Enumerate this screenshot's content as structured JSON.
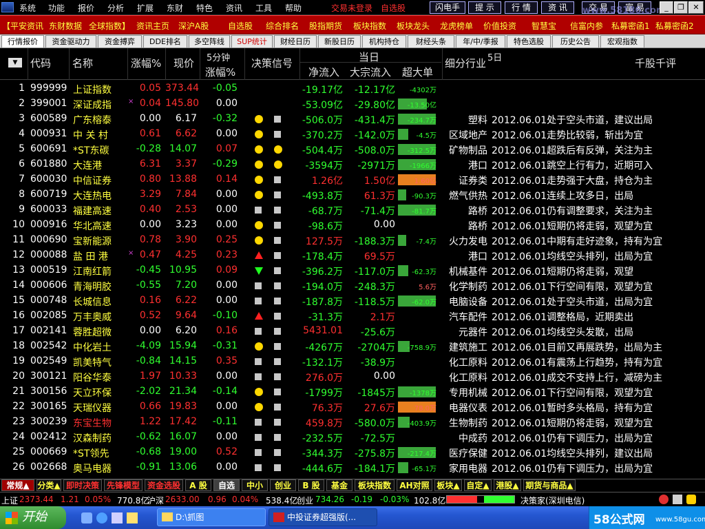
{
  "menu": {
    "items": [
      "系统",
      "功能",
      "报价",
      "分析",
      "扩展",
      "东财",
      "特色",
      "资讯",
      "工具",
      "帮助"
    ],
    "trade_status": "交易未登录",
    "self_select": "自选股",
    "buttons": [
      "闪电手",
      "提 示",
      "行 情",
      "资 讯",
      "交 易",
      "富 易"
    ],
    "watermark": "www.58186.com"
  },
  "linkbar": [
    "【平安资讯",
    "东财数据",
    "全球指数】",
    "资讯主页",
    "深沪A股",
    "自选股",
    "综合排名",
    "股指期货",
    "板块指数",
    "板块龙头",
    "龙虎榜单",
    "价值投资",
    "智慧宝",
    "信富内参",
    "私募密函1",
    "私募密函2"
  ],
  "tabs": [
    "行情报价",
    "资金驱动力",
    "资金搏弈",
    "DDE排名",
    "多空阵线",
    "SUP统计",
    "财经日历",
    "新股日历",
    "机构持仓",
    "财经头条",
    "年/中/季报",
    "特色选股",
    "历史公告",
    "宏观指数"
  ],
  "header": {
    "code": "代码",
    "name": "名称",
    "change_pct": "涨幅%",
    "price": "现价",
    "five_min_top": "5分钟",
    "five_min_bottom": "涨幅%",
    "signal": "决策信号",
    "today": "当日",
    "net_inflow": "净流入",
    "block_inflow": "大宗流入",
    "super_order": "超大单",
    "industry": "细分行业",
    "five_day": "5日",
    "comment": "千股千评"
  },
  "rows": [
    {
      "no": "1",
      "code": "999999",
      "name": "上证指数",
      "mark": "",
      "chg": "0.05",
      "price": "373.44",
      "m5": "-0.05",
      "sig1": "",
      "sig2": "",
      "net": "-19.17亿",
      "blk": "-12.17亿",
      "bar": "-4302万",
      "barv": 0,
      "ind": "",
      "cmt": ""
    },
    {
      "no": "2",
      "code": "399001",
      "name": "深证成指",
      "mark": "×",
      "chg": "0.04",
      "price": "145.80",
      "m5": "0.00",
      "sig1": "",
      "sig2": "",
      "net": "-53.09亿",
      "blk": "-29.80亿",
      "bar": "-13.50亿",
      "barv": 0.72,
      "ind": "",
      "cmt": ""
    },
    {
      "no": "3",
      "code": "600589",
      "name": "广东榕泰",
      "mark": "",
      "chg": "0.00",
      "price": "6.17",
      "m5": "-0.32",
      "sig1": "dot",
      "sig2": "sq",
      "net": "-506.0万",
      "blk": "-431.4万",
      "bar": "-234.7万",
      "barv": 0.95,
      "ind": "塑料",
      "cmt": "2012.06.01处于空头市道，建议出局"
    },
    {
      "no": "4",
      "code": "000931",
      "name": "中 关 村",
      "mark": "",
      "chg": "0.61",
      "price": "6.62",
      "m5": "0.00",
      "sig1": "dot",
      "sig2": "sq",
      "net": "-370.2万",
      "blk": "-142.0万",
      "bar": "-4.5万",
      "barv": 0.25,
      "ind": "区域地产",
      "cmt": "2012.06.01走势比较弱，斩出为宜"
    },
    {
      "no": "5",
      "code": "600691",
      "name": "*ST东碳",
      "mark": "",
      "chg": "-0.28",
      "price": "14.07",
      "m5": "0.07",
      "sig1": "dot",
      "sig2": "dot",
      "net": "-504.4万",
      "blk": "-508.0万",
      "bar": "-312.5万",
      "barv": 0.95,
      "ind": "矿物制品",
      "cmt": "2012.06.01超跌后有反弹，关注为主"
    },
    {
      "no": "6",
      "code": "601880",
      "name": "大连港",
      "mark": "",
      "chg": "6.31",
      "price": "3.37",
      "m5": "-0.29",
      "sig1": "dot",
      "sig2": "dot",
      "net": "-3594万",
      "blk": "-2971万",
      "bar": "-1966万",
      "barv": 0.95,
      "ind": "港口",
      "cmt": "2012.06.01跳空上行有力，近期可入"
    },
    {
      "no": "7",
      "code": "600030",
      "name": "中信证券",
      "mark": "",
      "chg": "0.80",
      "price": "13.88",
      "m5": "0.14",
      "sig1": "dot",
      "sig2": "sq",
      "net": "1.26亿",
      "blk": "1.50亿",
      "bar": "1.60亿",
      "barv": 0.95,
      "ind": "证券类",
      "cmt": "2012.06.01走势强于大盘，持仓为主"
    },
    {
      "no": "8",
      "code": "600719",
      "name": "大连热电",
      "mark": "",
      "chg": "3.29",
      "price": "7.84",
      "m5": "0.00",
      "sig1": "dot",
      "sig2": "sq",
      "net": "-493.8万",
      "blk": "61.3万",
      "bar": "-90.3万",
      "barv": 0.2,
      "ind": "燃气供热",
      "cmt": "2012.06.01连续上攻多日，出局"
    },
    {
      "no": "9",
      "code": "600033",
      "name": "福建高速",
      "mark": "",
      "chg": "0.40",
      "price": "2.53",
      "m5": "0.00",
      "sig1": "sq",
      "sig2": "sq",
      "net": "-68.7万",
      "blk": "-71.4万",
      "bar": "-81.7万",
      "barv": 0.95,
      "ind": "路桥",
      "cmt": "2012.06.01仍有调整要求，关注为主"
    },
    {
      "no": "10",
      "code": "000916",
      "name": "华北高速",
      "mark": "",
      "chg": "0.00",
      "price": "3.23",
      "m5": "0.00",
      "sig1": "dot",
      "sig2": "sq",
      "net": "-98.6万",
      "blk": "0.00",
      "bar": "",
      "barv": 0,
      "ind": "路桥",
      "cmt": "2012.06.01短期仍将走弱，观望为宜"
    },
    {
      "no": "11",
      "code": "000690",
      "name": "宝新能源",
      "mark": "",
      "chg": "0.78",
      "price": "3.90",
      "m5": "0.25",
      "sig1": "dot",
      "sig2": "sq",
      "net": "127.5万",
      "blk": "-188.3万",
      "bar": "-7.4万",
      "barv": 0.2,
      "ind": "火力发电",
      "cmt": "2012.06.01中期有走好迹象，持有为宜"
    },
    {
      "no": "12",
      "code": "000088",
      "name": "盐 田 港",
      "mark": "×",
      "chg": "0.47",
      "price": "4.25",
      "m5": "0.23",
      "sig1": "up",
      "sig2": "sq",
      "net": "-178.4万",
      "blk": "69.5万",
      "bar": "",
      "barv": 0,
      "ind": "港口",
      "cmt": "2012.06.01均线空头排列，出局为宜"
    },
    {
      "no": "13",
      "code": "000519",
      "name": "江南红箭",
      "mark": "",
      "chg": "-0.45",
      "price": "10.95",
      "m5": "0.09",
      "sig1": "down",
      "sig2": "sq",
      "net": "-396.2万",
      "blk": "-117.0万",
      "bar": "-62.3万",
      "barv": 0.25,
      "ind": "机械基件",
      "cmt": "2012.06.01短期仍将走弱，观望"
    },
    {
      "no": "14",
      "code": "000606",
      "name": "青海明胶",
      "mark": "",
      "chg": "-0.55",
      "price": "7.20",
      "m5": "0.00",
      "sig1": "sq",
      "sig2": "sq",
      "net": "-194.0万",
      "blk": "-248.3万",
      "bar": "5.6万",
      "barv": 0,
      "ind": "化学制药",
      "cmt": "2012.06.01下行空间有限，观望为宜"
    },
    {
      "no": "15",
      "code": "000748",
      "name": "长城信息",
      "mark": "",
      "chg": "0.16",
      "price": "6.22",
      "m5": "0.00",
      "sig1": "sq",
      "sig2": "sq",
      "net": "-187.8万",
      "blk": "-118.5万",
      "bar": "-62.0万",
      "barv": 0.95,
      "ind": "电脑设备",
      "cmt": "2012.06.01处于空头市道，出局为宜"
    },
    {
      "no": "16",
      "code": "002085",
      "name": "万丰奥威",
      "mark": "",
      "chg": "0.52",
      "price": "9.64",
      "m5": "-0.10",
      "sig1": "up",
      "sig2": "sq",
      "net": "-31.3万",
      "blk": "2.1万",
      "bar": "",
      "barv": 0,
      "ind": "汽车配件",
      "cmt": "2012.06.01调整格局，近期卖出"
    },
    {
      "no": "17",
      "code": "002141",
      "name": "蓉胜超微",
      "mark": "",
      "chg": "0.00",
      "price": "6.20",
      "m5": "0.16",
      "sig1": "sq",
      "sig2": "sq",
      "net": "5431.01",
      "blk": "-25.6万",
      "bar": "",
      "barv": 0,
      "ind": "元器件",
      "cmt": "2012.06.01均线空头发散，出局"
    },
    {
      "no": "18",
      "code": "002542",
      "name": "中化岩土",
      "mark": "",
      "chg": "-4.09",
      "price": "15.94",
      "m5": "-0.31",
      "sig1": "dot",
      "sig2": "sq",
      "net": "-4267万",
      "blk": "-2704万",
      "bar": "-758.9万",
      "barv": 0.3,
      "ind": "建筑施工",
      "cmt": "2012.06.01目前又再展跌势，出局为主"
    },
    {
      "no": "19",
      "code": "002549",
      "name": "凯美特气",
      "mark": "",
      "chg": "-0.84",
      "price": "14.15",
      "m5": "0.35",
      "sig1": "sq",
      "sig2": "sq",
      "net": "-132.1万",
      "blk": "-38.9万",
      "bar": "",
      "barv": 0,
      "ind": "化工原料",
      "cmt": "2012.06.01有震荡上行趋势，持有为宜"
    },
    {
      "no": "20",
      "code": "300121",
      "name": "阳谷华泰",
      "mark": "",
      "chg": "1.97",
      "price": "10.33",
      "m5": "0.00",
      "sig1": "sq",
      "sig2": "sq",
      "net": "276.0万",
      "blk": "0.00",
      "bar": "",
      "barv": 0,
      "ind": "化工原料",
      "cmt": "2012.06.01成交不支持上行，减磅为主"
    },
    {
      "no": "21",
      "code": "300156",
      "name": "天立环保",
      "mark": "",
      "chg": "-2.02",
      "price": "21.34",
      "m5": "-0.14",
      "sig1": "dot",
      "sig2": "sq",
      "net": "-1799万",
      "blk": "-1845万",
      "bar": "-1378万",
      "barv": 0.95,
      "ind": "专用机械",
      "cmt": "2012.06.01下行空间有限，观望为宜"
    },
    {
      "no": "22",
      "code": "300165",
      "name": "天瑞仪器",
      "mark": "",
      "chg": "0.66",
      "price": "19.83",
      "m5": "0.00",
      "sig1": "dot",
      "sig2": "sq",
      "net": "76.3万",
      "blk": "27.6万",
      "bar": "78.0万",
      "barv": 0.95,
      "ind": "电器仪表",
      "cmt": "2012.06.01暂时多头格局，持有为宜"
    },
    {
      "no": "23",
      "code": "300239",
      "name": "东宝生物",
      "mark": "",
      "chg": "1.22",
      "price": "17.42",
      "m5": "-0.11",
      "sig1": "sq",
      "sig2": "sq",
      "net": "459.8万",
      "blk": "-580.0万",
      "bar": "-403.9万",
      "barv": 0.3,
      "ind": "生物制药",
      "cmt": "2012.06.01短期仍将走弱，观望为宜"
    },
    {
      "no": "24",
      "code": "002412",
      "name": "汉森制药",
      "mark": "",
      "chg": "-0.62",
      "price": "16.07",
      "m5": "0.00",
      "sig1": "sq",
      "sig2": "sq",
      "net": "-232.5万",
      "blk": "-72.5万",
      "bar": "",
      "barv": 0,
      "ind": "中成药",
      "cmt": "2012.06.01仍有下调压力，出局为宜"
    },
    {
      "no": "25",
      "code": "000669",
      "name": "*ST领先",
      "mark": "",
      "chg": "-0.68",
      "price": "19.00",
      "m5": "0.52",
      "sig1": "sq",
      "sig2": "sq",
      "net": "-344.3万",
      "blk": "-275.8万",
      "bar": "-217.4万",
      "barv": 0.95,
      "ind": "医疗保健",
      "cmt": "2012.06.01均线空头排列，建议出局"
    },
    {
      "no": "26",
      "code": "002668",
      "name": "奥马电器",
      "mark": "",
      "chg": "-0.91",
      "price": "13.06",
      "m5": "0.00",
      "sig1": "sq",
      "sig2": "sq",
      "net": "-444.6万",
      "blk": "-184.1万",
      "bar": "-65.1万",
      "barv": 0.25,
      "ind": "家用电器",
      "cmt": "2012.06.01仍有下调压力，出局为宜"
    }
  ],
  "bottom_tabs": [
    "常规▲",
    "分类▲",
    "即时决策",
    "先锋模型",
    "资金选股",
    "A 股",
    "自选",
    "中小",
    "创业",
    "B 股",
    "基金",
    "板块指数",
    "AH对照",
    "板块▲",
    "自定▲",
    "港股▲",
    "期货与商品▲"
  ],
  "statusbar": {
    "sh_label": "上证",
    "sh_value": "2373.44",
    "sh_change": "1.21",
    "sh_pct": "0.05%",
    "sh_amount": "770.8亿",
    "sz_label": "沪深",
    "sz_value": "2633.00",
    "sz_change": "0.96",
    "sz_pct": "0.04%",
    "sz_amount": "538.4亿",
    "cy_label": "创业",
    "cy_value": "734.26",
    "cy_change": "-0.19",
    "cy_pct": "-0.03%",
    "cy_amount": "102.8亿",
    "server": "决策家(深圳电信)"
  },
  "taskbar": {
    "start": "开始",
    "window1": "D:\\抓图",
    "window2": "中投证券超强版(...",
    "brand": "58公式网",
    "brand_url": "www.58gu.com"
  },
  "colors": {
    "up": "#ff3030",
    "down": "#30ff30",
    "name": "#ffff40",
    "header_bar": "#b00000"
  }
}
